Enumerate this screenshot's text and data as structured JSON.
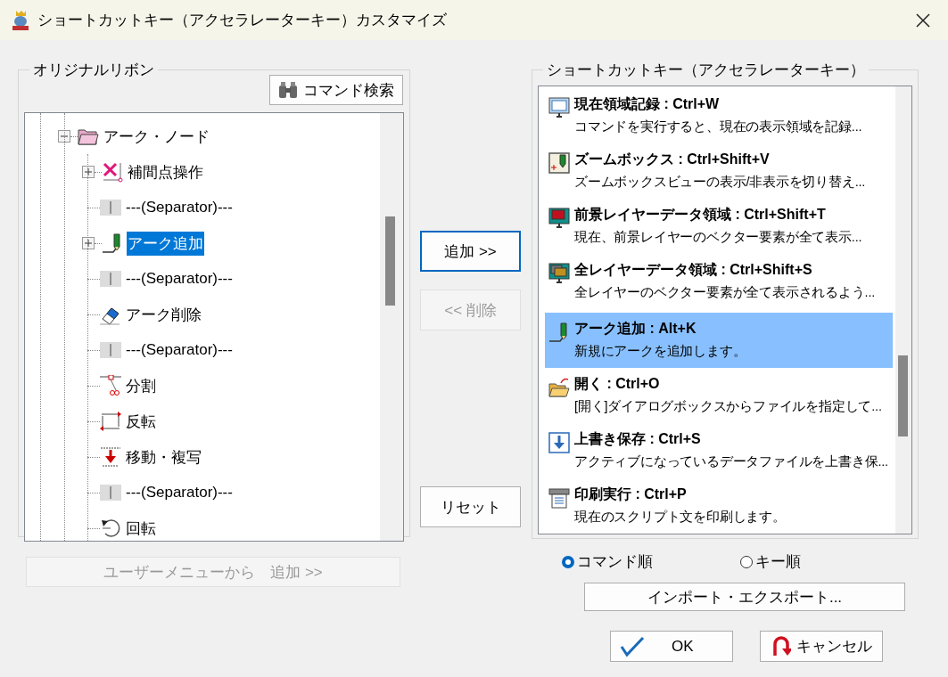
{
  "window": {
    "title": "ショートカットキー（アクセラレーターキー）カスタマイズ"
  },
  "ribbon": {
    "legend": "オリジナルリボン",
    "search_button": "コマンド検索",
    "tree": [
      {
        "label": "アーク・ノード",
        "kind": "folder",
        "expanded": true,
        "selected": false,
        "children": [
          {
            "label": "補間点操作",
            "kind": "interpolate",
            "expanded": false,
            "selected": false
          },
          {
            "label": "---(Separator)---",
            "kind": "separator",
            "selected": false
          },
          {
            "label": "アーク追加",
            "kind": "pen",
            "expanded": false,
            "selected": true
          },
          {
            "label": "---(Separator)---",
            "kind": "separator",
            "selected": false
          },
          {
            "label": "アーク削除",
            "kind": "eraser",
            "selected": false
          },
          {
            "label": "---(Separator)---",
            "kind": "separator",
            "selected": false
          },
          {
            "label": "分割",
            "kind": "split",
            "selected": false
          },
          {
            "label": "反転",
            "kind": "flip",
            "selected": false
          },
          {
            "label": "移動・複写",
            "kind": "move",
            "selected": false
          },
          {
            "label": "---(Separator)---",
            "kind": "separator",
            "selected": false
          },
          {
            "label": "回転",
            "kind": "rotate",
            "selected": false
          }
        ]
      }
    ],
    "user_menu_button": {
      "label": "ユーザーメニューから　追加 >>",
      "disabled": true
    }
  },
  "middle_buttons": [
    {
      "label": "追加 >>",
      "disabled": false,
      "focused": true
    },
    {
      "label": "<< 削除",
      "disabled": true,
      "focused": false
    },
    {
      "label": "リセット",
      "disabled": false,
      "focused": false
    }
  ],
  "shortcuts": {
    "legend": "ショートカットキー（アクセラレーターキー）",
    "items": [
      {
        "title": "現在領域記録 : Ctrl+W",
        "description": "コマンドを実行すると、現在の表示領域を記録...",
        "kind": "monitor",
        "selected": false
      },
      {
        "title": "ズームボックス : Ctrl+Shift+V",
        "description": "ズームボックスビューの表示/非表示を切り替え...",
        "kind": "zoombox",
        "selected": false
      },
      {
        "title": "前景レイヤーデータ領域 : Ctrl+Shift+T",
        "description": "現在、前景レイヤーのベクター要素が全て表示...",
        "kind": "foreground",
        "selected": false
      },
      {
        "title": "全レイヤーデータ領域 : Ctrl+Shift+S",
        "description": "全レイヤーのベクター要素が全て表示されるよう...",
        "kind": "layers",
        "selected": false
      },
      {
        "title": "アーク追加 : Alt+K",
        "description": "新規にアークを追加します。",
        "kind": "pen",
        "selected": true
      },
      {
        "title": "開く : Ctrl+O",
        "description": "[開く]ダイアログボックスからファイルを指定して...",
        "kind": "open",
        "selected": false
      },
      {
        "title": "上書き保存 : Ctrl+S",
        "description": "アクティブになっているデータファイルを上書き保...",
        "kind": "save",
        "selected": false
      },
      {
        "title": "印刷実行 : Ctrl+P",
        "description": "現在のスクリプト文を印刷します。",
        "kind": "print",
        "selected": false
      }
    ],
    "sort": [
      {
        "label": "コマンド順",
        "selected": true
      },
      {
        "label": "キー順",
        "selected": false
      }
    ],
    "import_export_button": "インポート・エクスポート..."
  },
  "ok_button": "OK",
  "cancel_button": "キャンセル"
}
